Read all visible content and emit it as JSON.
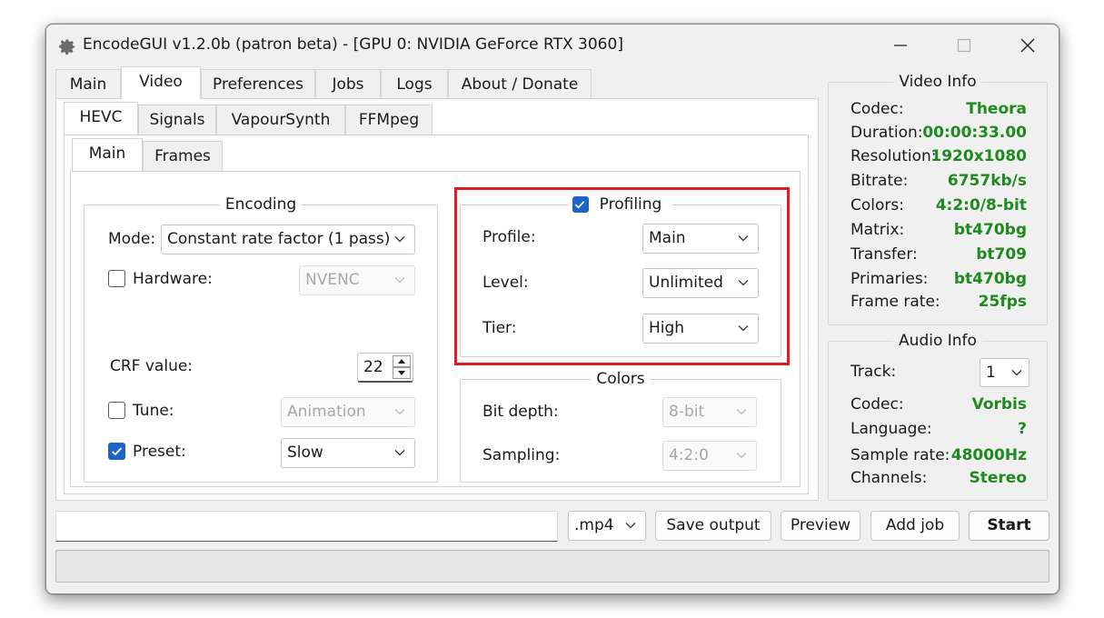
{
  "window": {
    "title": "EncodeGUI v1.2.0b (patron beta) - [GPU 0: NVIDIA GeForce RTX 3060]",
    "app_icon": "gear-icon",
    "controls": [
      "minimize-icon",
      "maximize-icon",
      "close-icon"
    ]
  },
  "main_tabs": [
    "Main",
    "Video",
    "Preferences",
    "Jobs",
    "Logs",
    "About / Donate"
  ],
  "main_tabs_active": "Video",
  "codec_tabs": [
    "HEVC",
    "Signals",
    "VapourSynth",
    "FFMpeg"
  ],
  "codec_tabs_active": "HEVC",
  "sub_tabs": [
    "Main",
    "Frames"
  ],
  "sub_tabs_active": "Main",
  "encoding": {
    "title": "Encoding",
    "mode_label": "Mode:",
    "mode_value": "Constant rate factor (1 pass)",
    "hardware_label": "Hardware:",
    "hardware_checked": false,
    "hardware_value": "NVENC",
    "crf_label": "CRF value:",
    "crf_value": "22",
    "tune_label": "Tune:",
    "tune_checked": false,
    "tune_value": "Animation",
    "preset_label": "Preset:",
    "preset_checked": true,
    "preset_value": "Slow"
  },
  "profiling": {
    "title": "Profiling",
    "enabled": true,
    "profile_label": "Profile:",
    "profile_value": "Main",
    "level_label": "Level:",
    "level_value": "Unlimited",
    "tier_label": "Tier:",
    "tier_value": "High",
    "highlight_color": "#e01b24"
  },
  "colors": {
    "title": "Colors",
    "bitdepth_label": "Bit depth:",
    "bitdepth_value": "8-bit",
    "sampling_label": "Sampling:",
    "sampling_value": "4:2:0"
  },
  "video_info": {
    "title": "Video Info",
    "rows": [
      {
        "label": "Codec:",
        "value": "Theora"
      },
      {
        "label": "Duration:",
        "value": "00:00:33.00"
      },
      {
        "label": "Resolution:",
        "value": "1920x1080"
      },
      {
        "label": "Bitrate:",
        "value": "6757kb/s"
      },
      {
        "label": "Colors:",
        "value": "4:2:0/8-bit"
      },
      {
        "label": "Matrix:",
        "value": "bt470bg"
      },
      {
        "label": "Transfer:",
        "value": "bt709"
      },
      {
        "label": "Primaries:",
        "value": "bt470bg"
      },
      {
        "label": "Frame rate:",
        "value": "25fps"
      }
    ],
    "value_color": "#1f8a1f"
  },
  "audio_info": {
    "title": "Audio Info",
    "track_label": "Track:",
    "track_value": "1",
    "rows": [
      {
        "label": "Codec:",
        "value": "Vorbis"
      },
      {
        "label": "Language:",
        "value": "?"
      },
      {
        "label": "Sample rate:",
        "value": "48000Hz"
      },
      {
        "label": "Channels:",
        "value": "Stereo"
      }
    ]
  },
  "bottom": {
    "output_path": "",
    "container_value": ".mp4",
    "save_output_label": "Save output",
    "preview_label": "Preview",
    "add_job_label": "Add job",
    "start_label": "Start",
    "progress": 0
  }
}
